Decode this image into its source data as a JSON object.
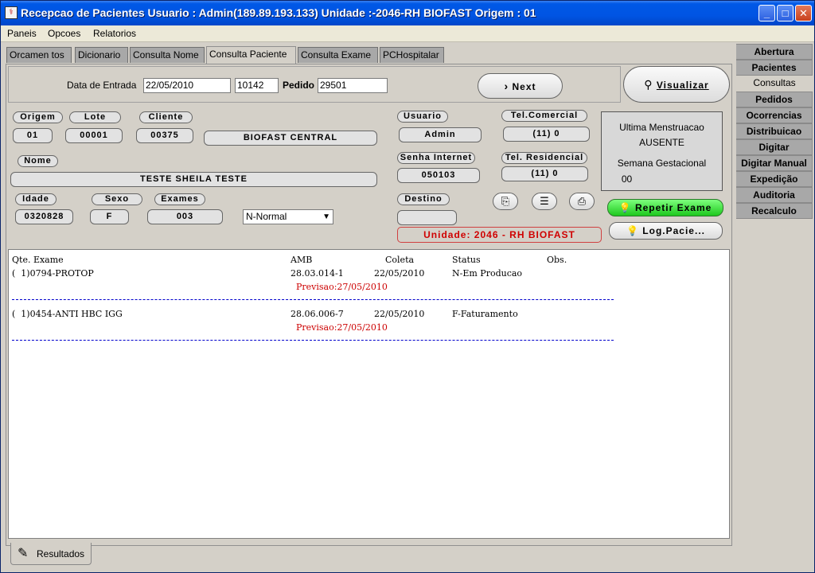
{
  "window": {
    "title": "Recepcao de Pacientes Usuario : Admin(189.89.193.133)  Unidade :-2046-RH BIOFAST Origem : 01",
    "icon": "app-icon",
    "minimize": "_",
    "maximize": "□",
    "close": "✕"
  },
  "menu": [
    "Paneis",
    "Opcoes",
    "Relatorios"
  ],
  "tabs": [
    "Orcamen tos",
    "Dicionario",
    "Consulta Nome",
    "Consulta Paciente",
    "Consulta Exame",
    "PCHospitalar"
  ],
  "active_tab": "Consulta Paciente",
  "entry": {
    "data_label": "Data de Entrada",
    "data_value": "22/05/2010",
    "code_value": "10142",
    "pedido_label": "Pedido",
    "pedido_value": "29501",
    "next_label": "Next",
    "next_icon": "chevron-right-icon",
    "visualizar_label": "Visualizar",
    "visualizar_icon": "binoculars-icon"
  },
  "patient": {
    "origem_label": "Origem",
    "origem": "01",
    "lote_label": "Lote",
    "lote": "00001",
    "cliente_label": "Cliente",
    "cliente": "00375",
    "cliente_name": "BIOFAST CENTRAL",
    "nome_label": "Nome",
    "nome": "TESTE SHEILA TESTE",
    "idade_label": "Idade",
    "idade": "0320828",
    "sexo_label": "Sexo",
    "sexo": "F",
    "exames_label": "Exames",
    "exames": "003",
    "status_select": "N-Normal",
    "usuario_label": "Usuario",
    "usuario": "Admin",
    "tel_comercial_label": "Tel.Comercial",
    "tel_comercial": "(11) 0",
    "senha_label": "Senha Internet",
    "senha": "050103",
    "tel_residencial_label": "Tel. Residencial",
    "tel_residencial": "(11) 0",
    "destino_label": "Destino",
    "destino": "",
    "unidade": "Unidade: 2046 - RH BIOFAST"
  },
  "info": {
    "line1": "Ultima Menstruacao",
    "line2": "AUSENTE",
    "line3": "Semana Gestacional",
    "line4": "00"
  },
  "actions": {
    "copy_icon": "copy-icon",
    "list_icon": "list-icon",
    "print_icon": "printer-icon",
    "repetir": "Repetir Exame",
    "log": "Log.Pacie...",
    "bulb_icon": "lightbulb-icon"
  },
  "results": {
    "header": {
      "qte": "Qte. Exame",
      "amb": "AMB",
      "coleta": "Coleta",
      "status": "Status",
      "obs": "Obs."
    },
    "rows": [
      {
        "qte": "(  1)0794-PROTOP",
        "amb": "28.03.014-1",
        "coleta": "22/05/2010",
        "status": "N-Em Producao",
        "previsao": "Previsao:27/05/2010"
      },
      {
        "qte": "(  1)0454-ANTI HBC IGG",
        "amb": "28.06.006-7",
        "coleta": "22/05/2010",
        "status": "F-Faturamento",
        "previsao": "Previsao:27/05/2010"
      }
    ]
  },
  "bottom_tab": {
    "label": "Resultados",
    "icon": "edit-icon"
  },
  "sidebar": [
    "Abertura",
    "Pacientes",
    "Consultas",
    "Pedidos",
    "Ocorrencias",
    "Distribuicao",
    "Digitar",
    "Digitar Manual",
    "Expedição",
    "Auditoria",
    "Recalculo"
  ],
  "sidebar_active": "Consultas",
  "colors": {
    "title_bar": "#0054e3",
    "accent_red": "#cc0000",
    "repeat_button": "#33d633"
  }
}
